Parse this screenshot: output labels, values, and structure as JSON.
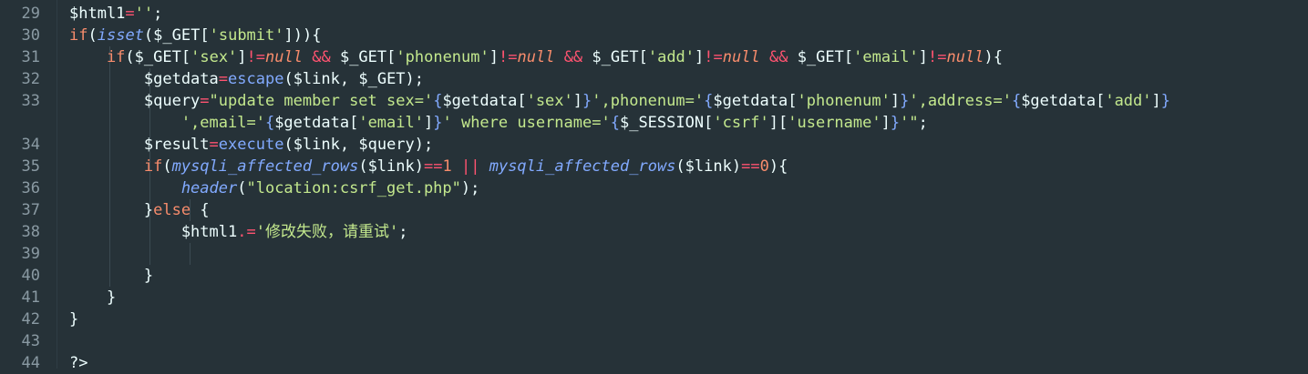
{
  "editor": {
    "line_numbers": [
      "29",
      "30",
      "31",
      "32",
      "33",
      "34",
      "35",
      "36",
      "37",
      "38",
      "39",
      "40",
      "41",
      "42",
      "43",
      "44"
    ],
    "lines": [
      {
        "tokens": [
          {
            "t": "$html1",
            "c": "var"
          },
          {
            "t": "=",
            "c": "op"
          },
          {
            "t": "''",
            "c": "str"
          },
          {
            "t": ";",
            "c": "pun"
          }
        ]
      },
      {
        "tokens": [
          {
            "t": "if",
            "c": "kw"
          },
          {
            "t": "(",
            "c": "pun"
          },
          {
            "t": "isset",
            "c": "fn-it"
          },
          {
            "t": "(",
            "c": "pun"
          },
          {
            "t": "$_GET",
            "c": "var"
          },
          {
            "t": "[",
            "c": "pun"
          },
          {
            "t": "'submit'",
            "c": "str"
          },
          {
            "t": "])){",
            "c": "pun"
          }
        ]
      },
      {
        "tokens": [
          {
            "t": "    if",
            "c": "kw"
          },
          {
            "t": "(",
            "c": "pun"
          },
          {
            "t": "$_GET",
            "c": "var"
          },
          {
            "t": "[",
            "c": "pun"
          },
          {
            "t": "'sex'",
            "c": "str"
          },
          {
            "t": "]",
            "c": "pun"
          },
          {
            "t": "!=",
            "c": "op"
          },
          {
            "t": "null",
            "c": "kw-it"
          },
          {
            "t": " ",
            "c": "pun"
          },
          {
            "t": "&&",
            "c": "op"
          },
          {
            "t": " $_GET",
            "c": "var"
          },
          {
            "t": "[",
            "c": "pun"
          },
          {
            "t": "'phonenum'",
            "c": "str"
          },
          {
            "t": "]",
            "c": "pun"
          },
          {
            "t": "!=",
            "c": "op"
          },
          {
            "t": "null",
            "c": "kw-it"
          },
          {
            "t": " ",
            "c": "pun"
          },
          {
            "t": "&&",
            "c": "op"
          },
          {
            "t": " $_GET",
            "c": "var"
          },
          {
            "t": "[",
            "c": "pun"
          },
          {
            "t": "'add'",
            "c": "str"
          },
          {
            "t": "]",
            "c": "pun"
          },
          {
            "t": "!=",
            "c": "op"
          },
          {
            "t": "null",
            "c": "kw-it"
          },
          {
            "t": " ",
            "c": "pun"
          },
          {
            "t": "&&",
            "c": "op"
          },
          {
            "t": " $_GET",
            "c": "var"
          },
          {
            "t": "[",
            "c": "pun"
          },
          {
            "t": "'email'",
            "c": "str"
          },
          {
            "t": "]",
            "c": "pun"
          },
          {
            "t": "!=",
            "c": "op"
          },
          {
            "t": "null",
            "c": "kw-it"
          },
          {
            "t": "){",
            "c": "pun"
          }
        ]
      },
      {
        "tokens": [
          {
            "t": "        $getdata",
            "c": "var"
          },
          {
            "t": "=",
            "c": "op"
          },
          {
            "t": "escape",
            "c": "fn"
          },
          {
            "t": "(",
            "c": "pun"
          },
          {
            "t": "$link",
            "c": "var"
          },
          {
            "t": ", ",
            "c": "pun"
          },
          {
            "t": "$_GET",
            "c": "var"
          },
          {
            "t": ");",
            "c": "pun"
          }
        ]
      },
      {
        "tokens": [
          {
            "t": "        $query",
            "c": "var"
          },
          {
            "t": "=",
            "c": "op"
          },
          {
            "t": "\"update member set sex='",
            "c": "str"
          },
          {
            "t": "{",
            "c": "fn"
          },
          {
            "t": "$getdata",
            "c": "var"
          },
          {
            "t": "[",
            "c": "pun"
          },
          {
            "t": "'sex'",
            "c": "str"
          },
          {
            "t": "]",
            "c": "pun"
          },
          {
            "t": "}",
            "c": "fn"
          },
          {
            "t": "',phonenum='",
            "c": "str"
          },
          {
            "t": "{",
            "c": "fn"
          },
          {
            "t": "$getdata",
            "c": "var"
          },
          {
            "t": "[",
            "c": "pun"
          },
          {
            "t": "'phonenum'",
            "c": "str"
          },
          {
            "t": "]",
            "c": "pun"
          },
          {
            "t": "}",
            "c": "fn"
          },
          {
            "t": "',address='",
            "c": "str"
          },
          {
            "t": "{",
            "c": "fn"
          },
          {
            "t": "$getdata",
            "c": "var"
          },
          {
            "t": "[",
            "c": "pun"
          },
          {
            "t": "'add'",
            "c": "str"
          },
          {
            "t": "]",
            "c": "pun"
          },
          {
            "t": "}",
            "c": "fn"
          }
        ]
      },
      {
        "tokens": [
          {
            "t": "            ',email='",
            "c": "str"
          },
          {
            "t": "{",
            "c": "fn"
          },
          {
            "t": "$getdata",
            "c": "var"
          },
          {
            "t": "[",
            "c": "pun"
          },
          {
            "t": "'email'",
            "c": "str"
          },
          {
            "t": "]",
            "c": "pun"
          },
          {
            "t": "}",
            "c": "fn"
          },
          {
            "t": "' where username='",
            "c": "str"
          },
          {
            "t": "{",
            "c": "fn"
          },
          {
            "t": "$_SESSION",
            "c": "var"
          },
          {
            "t": "[",
            "c": "pun"
          },
          {
            "t": "'csrf'",
            "c": "str"
          },
          {
            "t": "][",
            "c": "pun"
          },
          {
            "t": "'username'",
            "c": "str"
          },
          {
            "t": "]",
            "c": "pun"
          },
          {
            "t": "}",
            "c": "fn"
          },
          {
            "t": "'\"",
            "c": "str"
          },
          {
            "t": ";",
            "c": "pun"
          }
        ]
      },
      {
        "tokens": [
          {
            "t": "        $result",
            "c": "var"
          },
          {
            "t": "=",
            "c": "op"
          },
          {
            "t": "execute",
            "c": "fn"
          },
          {
            "t": "(",
            "c": "pun"
          },
          {
            "t": "$link",
            "c": "var"
          },
          {
            "t": ", ",
            "c": "pun"
          },
          {
            "t": "$query",
            "c": "var"
          },
          {
            "t": ");",
            "c": "pun"
          }
        ]
      },
      {
        "tokens": [
          {
            "t": "        if",
            "c": "kw"
          },
          {
            "t": "(",
            "c": "pun"
          },
          {
            "t": "mysqli_affected_rows",
            "c": "fn-it"
          },
          {
            "t": "(",
            "c": "pun"
          },
          {
            "t": "$link",
            "c": "var"
          },
          {
            "t": ")",
            "c": "pun"
          },
          {
            "t": "==",
            "c": "op"
          },
          {
            "t": "1",
            "c": "num"
          },
          {
            "t": " ",
            "c": "pun"
          },
          {
            "t": "||",
            "c": "op"
          },
          {
            "t": " ",
            "c": "pun"
          },
          {
            "t": "mysqli_affected_rows",
            "c": "fn-it"
          },
          {
            "t": "(",
            "c": "pun"
          },
          {
            "t": "$link",
            "c": "var"
          },
          {
            "t": ")",
            "c": "pun"
          },
          {
            "t": "==",
            "c": "op"
          },
          {
            "t": "0",
            "c": "num"
          },
          {
            "t": "){",
            "c": "pun"
          }
        ]
      },
      {
        "tokens": [
          {
            "t": "            header",
            "c": "fn-it"
          },
          {
            "t": "(",
            "c": "pun"
          },
          {
            "t": "\"location:csrf_get.php\"",
            "c": "str"
          },
          {
            "t": ");",
            "c": "pun"
          }
        ]
      },
      {
        "tokens": [
          {
            "t": "        }",
            "c": "pun"
          },
          {
            "t": "else",
            "c": "kw"
          },
          {
            "t": " {",
            "c": "pun"
          }
        ]
      },
      {
        "tokens": [
          {
            "t": "            $html1",
            "c": "var"
          },
          {
            "t": ".=",
            "c": "op"
          },
          {
            "t": "'修改失败，请重试'",
            "c": "str"
          },
          {
            "t": ";",
            "c": "pun"
          }
        ]
      },
      {
        "tokens": [
          {
            "t": "",
            "c": "pun"
          }
        ]
      },
      {
        "tokens": [
          {
            "t": "        }",
            "c": "pun"
          }
        ]
      },
      {
        "tokens": [
          {
            "t": "    }",
            "c": "pun"
          }
        ]
      },
      {
        "tokens": [
          {
            "t": "}",
            "c": "pun"
          }
        ]
      },
      {
        "tokens": [
          {
            "t": "",
            "c": "pun"
          }
        ]
      },
      {
        "tokens": [
          {
            "t": "?>",
            "c": "pun"
          }
        ]
      }
    ],
    "colors": {
      "background": "#263238",
      "line_number": "#8a9aa3",
      "variable": "#eeffff",
      "string": "#c3e88d",
      "keyword": "#f78c6c",
      "function": "#82aaff",
      "operator": "#ff5370"
    }
  }
}
